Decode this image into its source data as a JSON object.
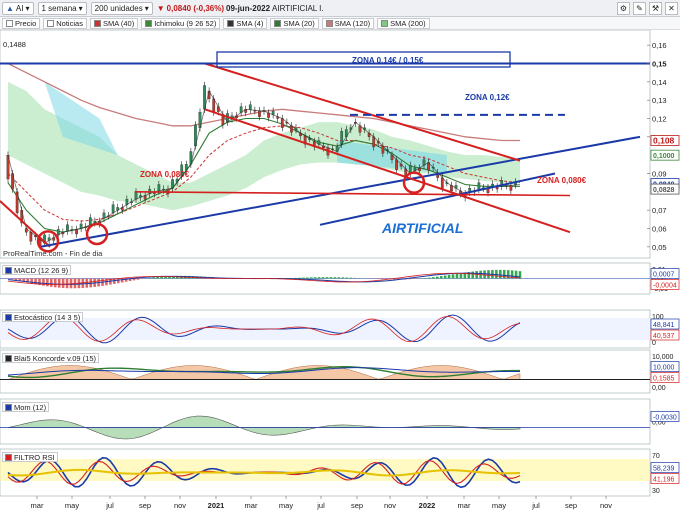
{
  "toolbar": {
    "symbol": "AI",
    "period": "1 semana",
    "units": "200 unidades",
    "price_change": "0,0840 (-0,36%)",
    "date": "09-jun-2022",
    "name": "AIRTIFICIAL I."
  },
  "indicators": [
    {
      "label": "Precio",
      "color": "#ffffff"
    },
    {
      "label": "Noticias",
      "color": "#ffffff"
    },
    {
      "label": "SMA (40)",
      "color": "#cc3333"
    },
    {
      "label": "Ichimoku (9 26 52)",
      "color": "#3a8a3a"
    },
    {
      "label": "SMA (4)",
      "color": "#333333"
    },
    {
      "label": "SMA (20)",
      "color": "#2e7d32"
    },
    {
      "label": "SMA (120)",
      "color": "#c97b7b"
    },
    {
      "label": "SMA (200)",
      "color": "#7fc97f"
    }
  ],
  "main_chart": {
    "title": "AIRTIFICIAL",
    "source": "ProRealTime.com - Fin de dia",
    "left_label": "0,1488",
    "y_ticks": [
      "0,16",
      "0,15",
      "0,14",
      "0,13",
      "0,12",
      "0,11",
      "0,09",
      "0,07",
      "0,06",
      "0,05"
    ],
    "price_tags": [
      {
        "label": "0,108",
        "color": "#c21919"
      },
      {
        "label": "0,1000",
        "color": "#3a8a3a"
      },
      {
        "label": "0,0840",
        "color": "#1a3aa8"
      },
      {
        "label": "0,0828",
        "color": "#555555"
      }
    ],
    "zones": [
      {
        "label": "ZONA 0,14€ / 0,15€",
        "color": "#1a3aa8"
      },
      {
        "label": "ZONA 0,12€",
        "color": "#1a3aa8"
      },
      {
        "label": "ZONA 0,080€",
        "color": "#d62020"
      },
      {
        "label": "ZONA 0,080€",
        "color": "#d62020"
      }
    ]
  },
  "x_axis": {
    "labels": [
      "mar",
      "may",
      "jul",
      "sep",
      "nov",
      "2021",
      "mar",
      "may",
      "jul",
      "sep",
      "nov",
      "2022",
      "mar",
      "may",
      "jul",
      "sep",
      "nov"
    ]
  },
  "panels": {
    "macd": {
      "label": "MACD (12 26 9)",
      "ticks": [
        "0,01",
        "0,00",
        "-0,01"
      ],
      "tags": [
        "0,0007",
        "-0,0004"
      ]
    },
    "stoch": {
      "label": "Estocástico (14 3 5)",
      "ticks": [
        "100",
        "0"
      ],
      "tags": [
        "48,841",
        "40,537"
      ]
    },
    "koncorde": {
      "label": "Blai5 Koncorde v.09 (15)",
      "ticks": [
        "10,000",
        "0,00"
      ],
      "tags": [
        "10,000",
        "0,1585"
      ]
    },
    "mom": {
      "label": "Mom (12)",
      "ticks": [
        "0,00"
      ],
      "tags": [
        "-0,0030"
      ]
    },
    "rsi": {
      "label": "FILTRO RSI",
      "ticks": [
        "70",
        "30"
      ],
      "tags": [
        "58,239",
        "41,196"
      ]
    }
  },
  "chart_data": {
    "type": "line",
    "title": "AIRTIFICIAL",
    "x": [
      "2020-02",
      "2020-03",
      "2020-04",
      "2020-05",
      "2020-06",
      "2020-07",
      "2020-08",
      "2020-09",
      "2020-10",
      "2020-11",
      "2020-12",
      "2021-01",
      "2021-02",
      "2021-03",
      "2021-04",
      "2021-05",
      "2021-06",
      "2021-07",
      "2021-08",
      "2021-09",
      "2021-10",
      "2021-11",
      "2021-12",
      "2022-01",
      "2022-02",
      "2022-03",
      "2022-04",
      "2022-05",
      "2022-06"
    ],
    "series": [
      {
        "name": "Precio",
        "values": [
          0.1,
          0.06,
          0.052,
          0.058,
          0.06,
          0.064,
          0.07,
          0.076,
          0.08,
          0.082,
          0.095,
          0.135,
          0.118,
          0.125,
          0.124,
          0.12,
          0.112,
          0.106,
          0.102,
          0.118,
          0.11,
          0.1,
          0.09,
          0.096,
          0.085,
          0.079,
          0.082,
          0.083,
          0.084
        ]
      }
    ],
    "ylim": [
      0.045,
      0.165
    ]
  }
}
